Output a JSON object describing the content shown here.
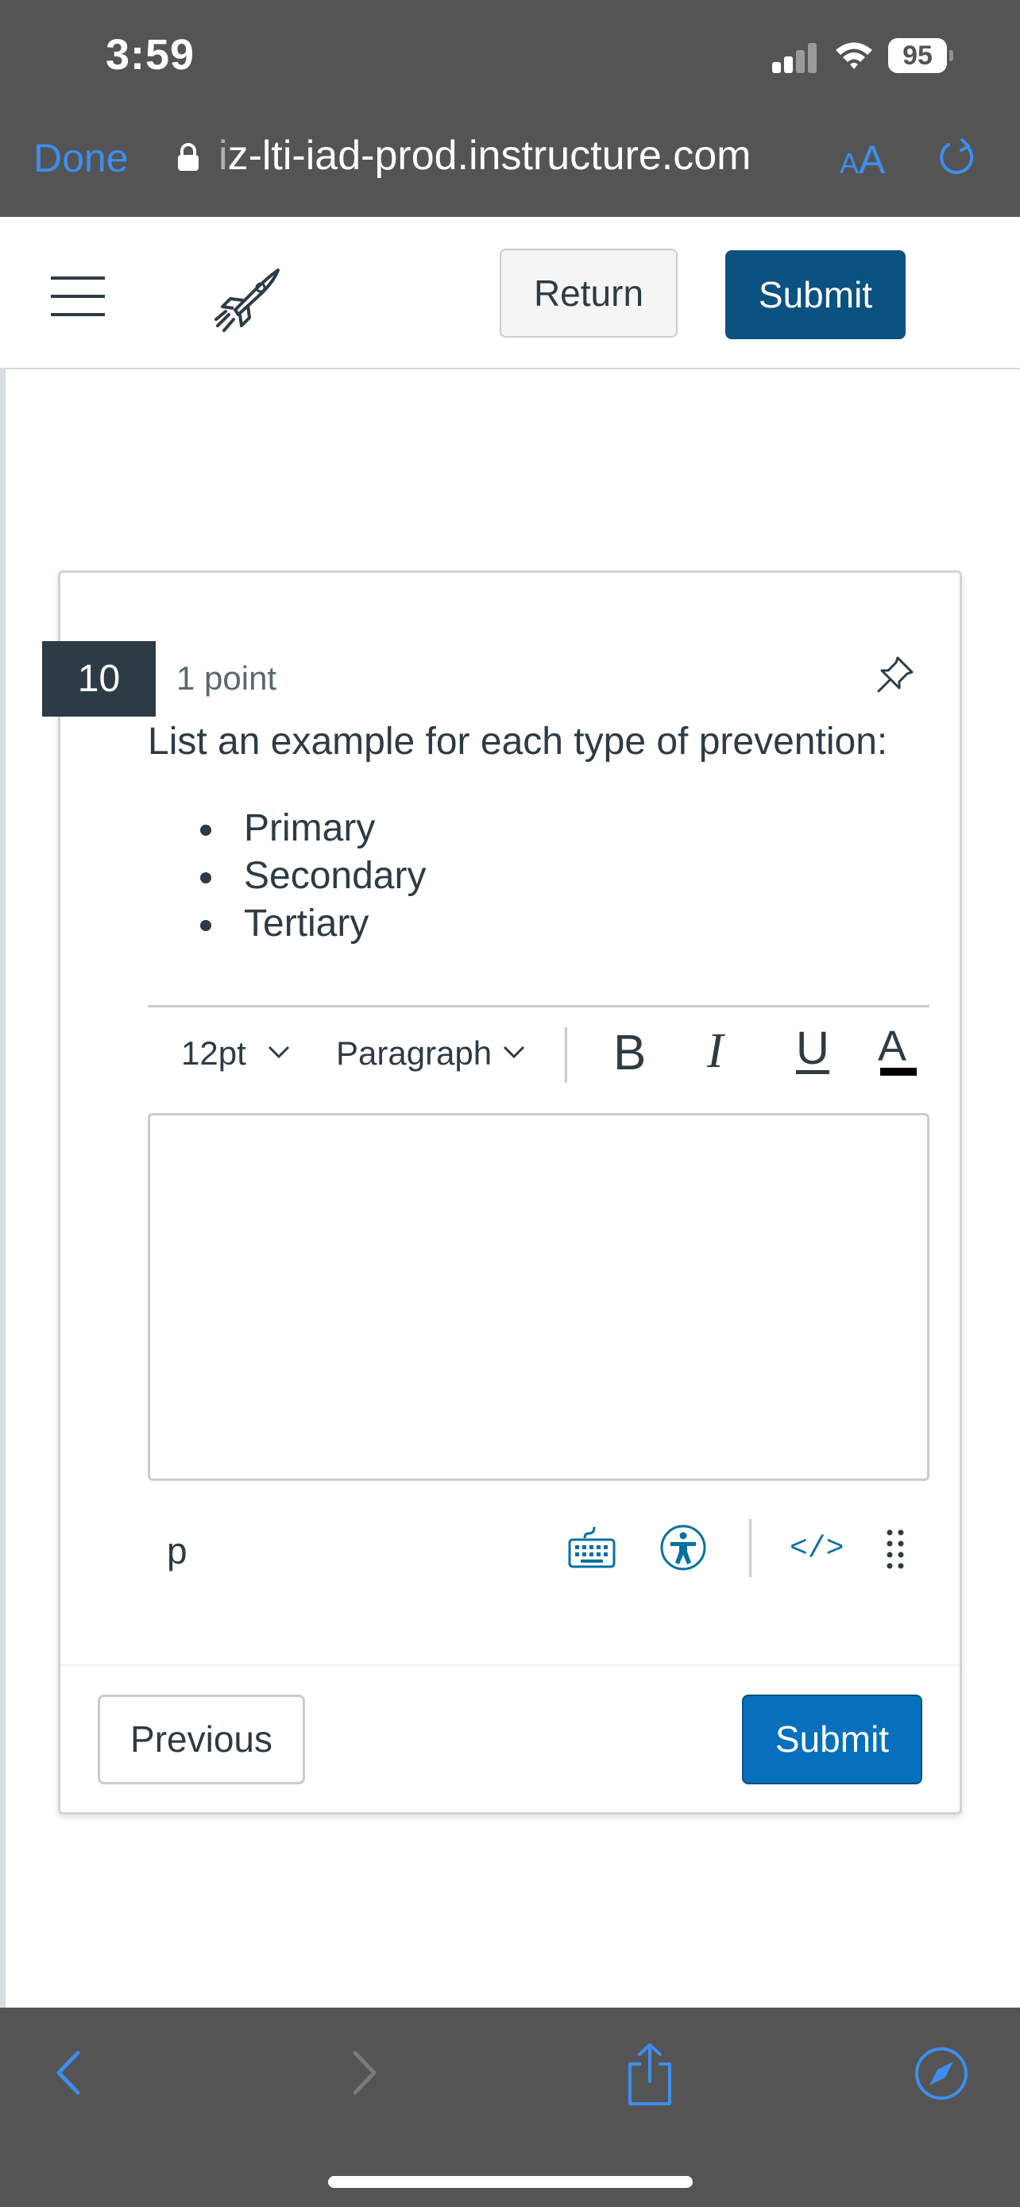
{
  "status_bar": {
    "time": "3:59",
    "battery": "95"
  },
  "safari": {
    "done_label": "Done",
    "url_prefix": "i",
    "url_rest": "z-lti-iad-prod.instructure.com",
    "aa_small": "A",
    "aa_big": "A"
  },
  "app_header": {
    "return_label": "Return",
    "submit_label": "Submit"
  },
  "question": {
    "number": "10",
    "points": "1 point",
    "text": "List an example for each type of prevention:",
    "items": [
      "Primary",
      "Secondary",
      "Tertiary"
    ]
  },
  "editor": {
    "font_size": "12pt",
    "block_format": "Paragraph",
    "bold": "B",
    "italic": "I",
    "underline": "U",
    "text_color": "A",
    "path": "p",
    "html_toggle": "</>"
  },
  "card_footer": {
    "previous_label": "Previous",
    "submit_label": "Submit"
  },
  "colors": {
    "chrome_bg": "#545454",
    "safari_blue": "#3d8eee",
    "primary_dark": "#0b5181",
    "primary": "#0770bd",
    "text": "#2d3b45"
  }
}
